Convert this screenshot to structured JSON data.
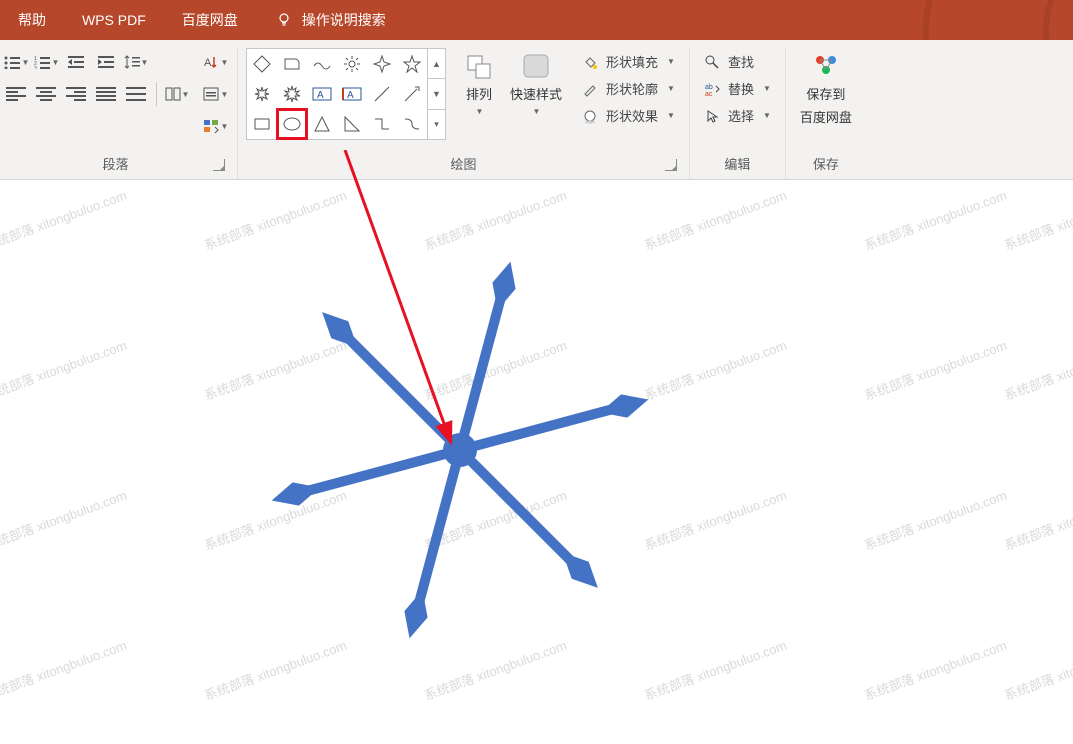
{
  "titlebar": {
    "tabs": [
      "帮助",
      "WPS PDF",
      "百度网盘"
    ],
    "search_placeholder": "操作说明搜索"
  },
  "paragraph": {
    "label": "段落"
  },
  "drawing": {
    "label": "绘图",
    "arrange": "排列",
    "quick_styles": "快速样式",
    "shape_fill": "形状填充",
    "shape_outline": "形状轮廓",
    "shape_effects": "形状效果",
    "shapes": [
      "diamond",
      "rounded-rect",
      "wave",
      "sun",
      "star4",
      "star5",
      "burst1",
      "burst2",
      "textbox-h",
      "textbox-v",
      "line",
      "line-arrow",
      "rect",
      "oval",
      "triangle",
      "right-triangle",
      "elbow",
      "curved-elbow"
    ]
  },
  "editing": {
    "label": "编辑",
    "find": "查找",
    "replace": "替换",
    "select": "选择"
  },
  "save": {
    "label": "保存",
    "line1": "保存到",
    "line2": "百度网盘"
  },
  "watermark": "系统部落 xitongbuluo.com",
  "accent": "#4472c4"
}
